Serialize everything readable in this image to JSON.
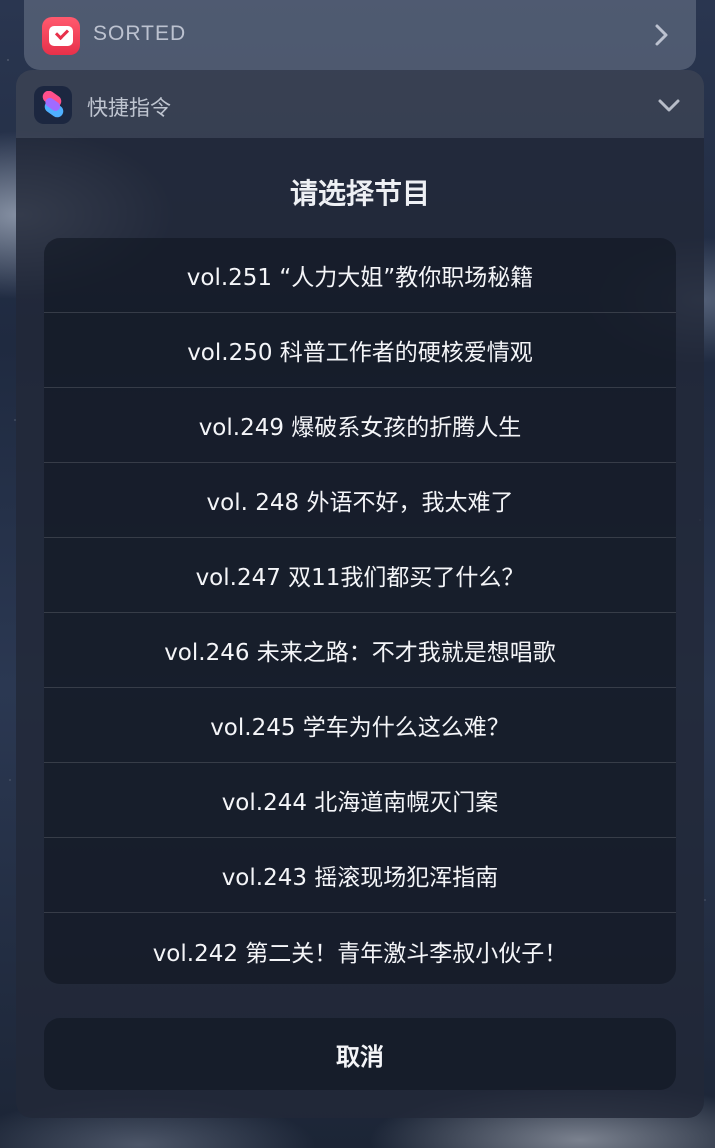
{
  "sorted_widget": {
    "title": "SORTED",
    "icon": "checkmark-app-icon",
    "accent": "#e8304a"
  },
  "shortcuts_widget": {
    "title": "快捷指令",
    "icon": "shortcuts-app-icon",
    "prompt": "请选择节目",
    "options": [
      "vol.251 “人力大姐”教你职场秘籍",
      "vol.250 科普工作者的硬核爱情观",
      "vol.249 爆破系女孩的折腾人生",
      "vol. 248 外语不好，我太难了",
      "vol.247 双11我们都买了什么？",
      "vol.246 未来之路：不才我就是想唱歌",
      "vol.245 学车为什么这么难？",
      "vol.244 北海道南幌灭门案",
      "vol.243 摇滚现场犯浑指南",
      "vol.242 第二关！青年激斗李叔小伙子！"
    ],
    "cancel_label": "取消"
  }
}
